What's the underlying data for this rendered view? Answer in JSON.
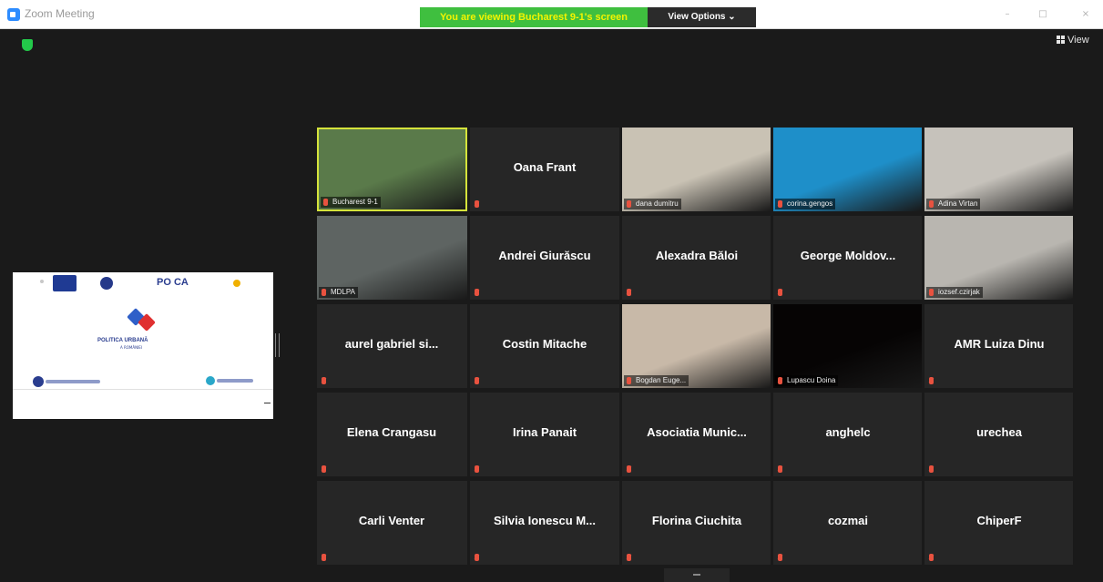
{
  "window": {
    "title": "Zoom Meeting",
    "controls": {
      "minimize": "–",
      "maximize": "□",
      "close": "×"
    }
  },
  "banner": {
    "text": "You are viewing Bucharest 9-1's screen"
  },
  "view_options": {
    "label": "View Options ⌄"
  },
  "view_button": {
    "label": "View"
  },
  "colors": {
    "banner_bg": "#3fbf3f",
    "banner_text": "#f4f400",
    "active_speaker": "#d5e33b",
    "muted_mic": "#e8523f"
  },
  "shared_screen": {
    "title": "POLITICA URBANĂ",
    "subtitle": "A ROMÂNIEI",
    "brand": "PO CA"
  },
  "participants": [
    {
      "name": "Bucharest 9-1",
      "video": true,
      "active": true
    },
    {
      "name": "Oana Frant",
      "video": false
    },
    {
      "name": "dana dumitru",
      "video": true
    },
    {
      "name": "corina.gengos",
      "video": true
    },
    {
      "name": "Adina Virtan",
      "video": true
    },
    {
      "name": "MDLPA",
      "video": true
    },
    {
      "name": "Andrei Giurăscu",
      "video": false
    },
    {
      "name": "Alexadra Băloi",
      "video": false
    },
    {
      "name": "George Moldov...",
      "video": false
    },
    {
      "name": "iozsef.czirjak",
      "video": true
    },
    {
      "name": "aurel gabriel si...",
      "video": false
    },
    {
      "name": "Costin Mitache",
      "video": false
    },
    {
      "name": "Bogdan Euge...",
      "video": true
    },
    {
      "name": "Lupascu Doina",
      "video": true
    },
    {
      "name": "AMR Luiza Dinu",
      "video": false
    },
    {
      "name": "Elena Crangasu",
      "video": false
    },
    {
      "name": "Irina Panait",
      "video": false
    },
    {
      "name": "Asociatia Munic...",
      "video": false
    },
    {
      "name": "anghelc",
      "video": false
    },
    {
      "name": "urechea",
      "video": false
    },
    {
      "name": "Carli Venter",
      "video": false
    },
    {
      "name": "Silvia Ionescu M...",
      "video": false
    },
    {
      "name": "Florina Ciuchita",
      "video": false
    },
    {
      "name": "cozmai",
      "video": false
    },
    {
      "name": "ChiperF",
      "video": false
    }
  ]
}
